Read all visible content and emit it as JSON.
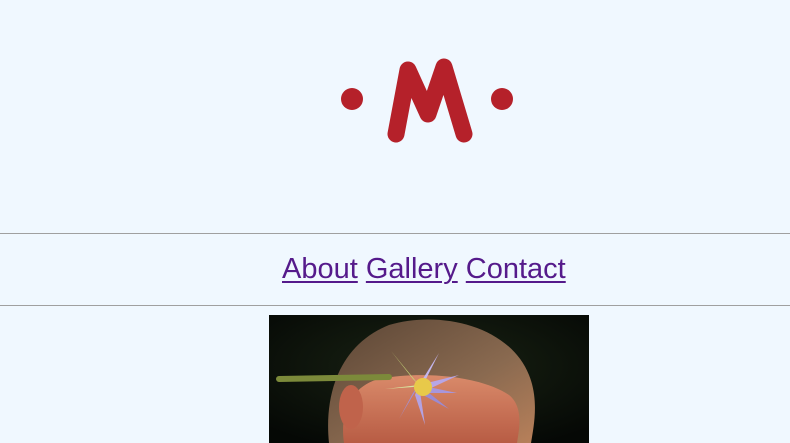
{
  "colors": {
    "background": "#f0f8ff",
    "brand": "#b5212a",
    "link": "#551a8b",
    "rule": "#a0a0a0"
  },
  "logo": {
    "text": "M",
    "icon": "dot-m-dot-logo"
  },
  "nav": {
    "items": [
      {
        "label": "About"
      },
      {
        "label": "Gallery"
      },
      {
        "label": "Contact"
      }
    ]
  },
  "hero_image": {
    "subject": "man-with-purple-water-lily-on-head"
  }
}
